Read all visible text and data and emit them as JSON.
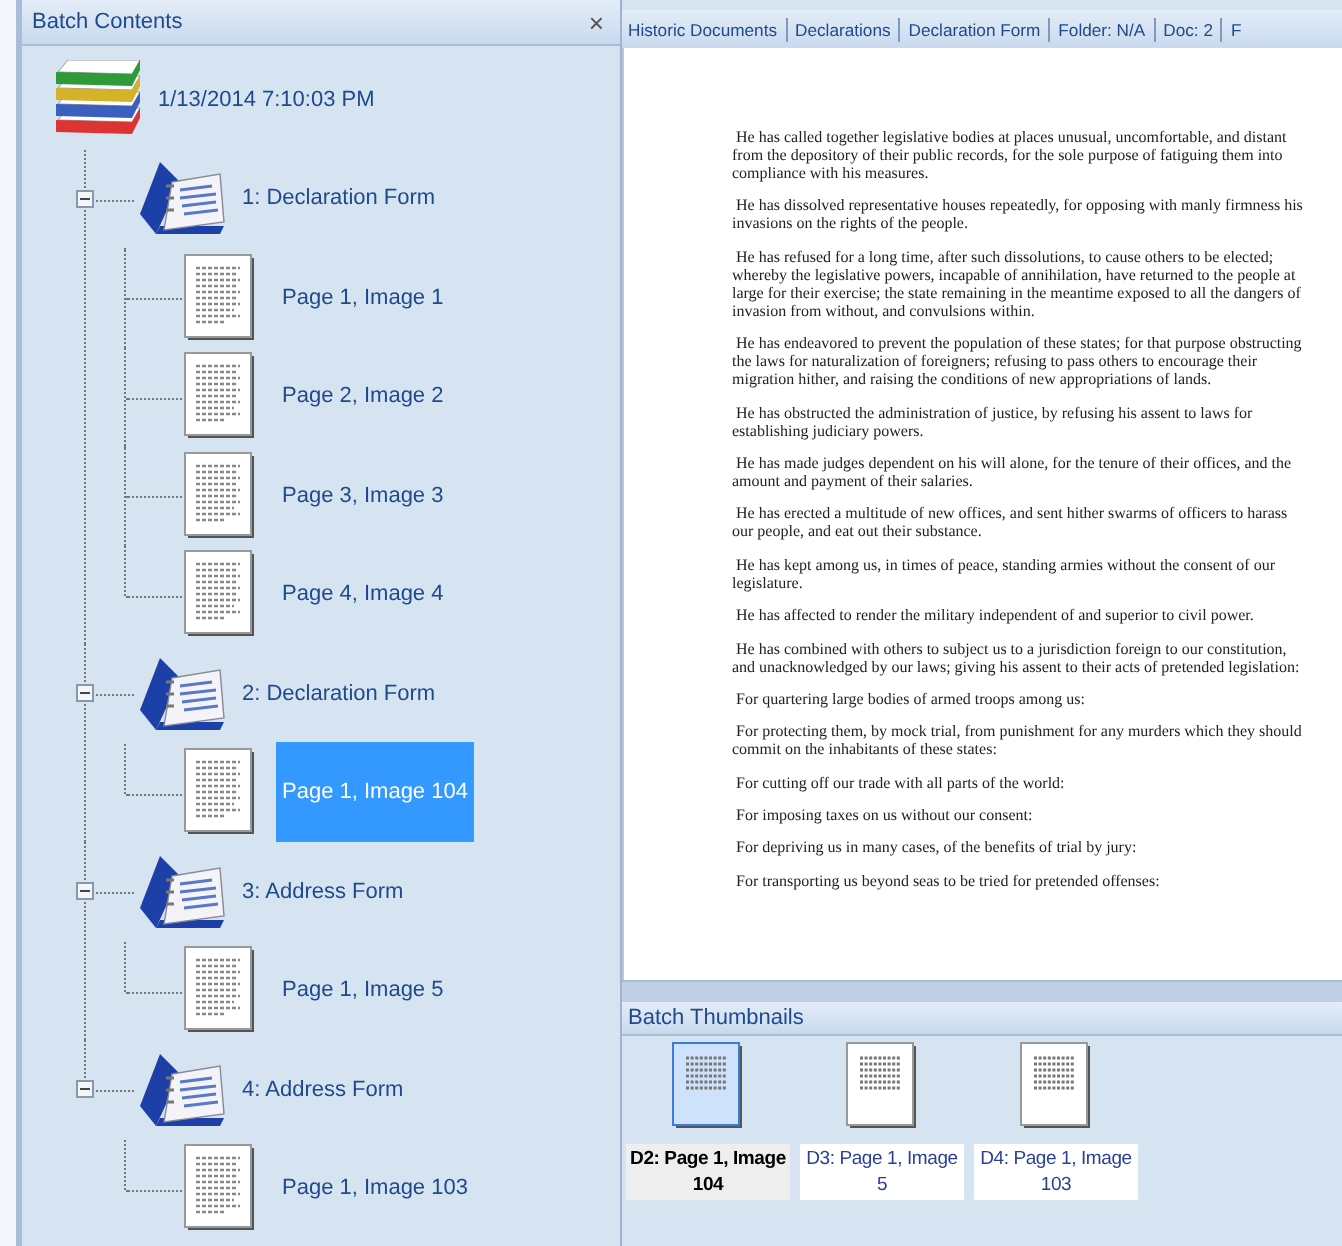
{
  "batch_contents": {
    "title": "Batch Contents",
    "close": "×",
    "root": {
      "label": "1/13/2014 7:10:03 PM",
      "children": [
        {
          "label": "1: Declaration Form",
          "expanded": true,
          "children": [
            {
              "label": "Page 1, Image 1",
              "selected": false
            },
            {
              "label": "Page 2, Image 2",
              "selected": false
            },
            {
              "label": "Page 3, Image 3",
              "selected": false
            },
            {
              "label": "Page 4, Image 4",
              "selected": false
            }
          ]
        },
        {
          "label": "2: Declaration Form",
          "expanded": true,
          "children": [
            {
              "label": "Page 1, Image 104",
              "selected": true
            }
          ]
        },
        {
          "label": "3: Address Form",
          "expanded": true,
          "children": [
            {
              "label": "Page 1, Image 5",
              "selected": false
            }
          ]
        },
        {
          "label": "4: Address Form",
          "expanded": true,
          "children": [
            {
              "label": "Page 1, Image 103",
              "selected": false
            }
          ]
        }
      ]
    }
  },
  "breadcrumb": [
    "Historic Documents",
    "Declarations",
    "Declaration Form",
    "Folder: N/A",
    "Doc: 2",
    "F"
  ],
  "document": {
    "paragraphs": [
      "He has called together legislative bodies at places unusual, uncomfortable, and distant from the depository of their public records, for the sole purpose of fatiguing them into compliance with his measures.",
      "He has dissolved representative houses repeatedly, for opposing with manly firmness his invasions on the rights of the people.",
      "He has refused for a long time, after such dissolutions, to cause others to be elected; whereby the legislative powers, incapable of annihilation, have returned to the people at large for their exercise; the state remaining in the meantime exposed to all the dangers of invasion from without, and convulsions within.",
      "He has endeavored to prevent the population of these states; for that purpose obstructing the laws for naturalization of foreigners; refusing to pass others to encourage their migration hither, and raising the conditions of new appropriations of lands.",
      "He has obstructed the administration of justice, by refusing his assent to laws for establishing judiciary powers.",
      "He has made judges dependent on his will alone, for the tenure of their offices, and the amount and payment of their salaries.",
      "He has erected a multitude of new offices, and sent hither swarms of officers to harass our people, and eat out their substance.",
      "He has kept among us, in times of peace, standing armies without the consent of our legislature.",
      "He has affected to render the military independent of and superior to civil power.",
      "He has combined with others to subject us to a jurisdiction foreign to our constitution, and unacknowledged by our laws; giving his assent to their acts of pretended legislation:",
      "For quartering large bodies of armed troops among us:",
      "For protecting them, by mock trial, from punishment for any murders which they should commit on the inhabitants of these states:",
      "For cutting off our trade with all parts of the world:",
      "For imposing taxes on us without our consent:",
      "For depriving us in many cases, of the benefits of trial by jury:",
      "For transporting us beyond seas to be tried for pretended offenses:"
    ]
  },
  "batch_thumbnails": {
    "title": "Batch Thumbnails",
    "items": [
      {
        "label": "D2: Page 1, Image 104",
        "selected": true
      },
      {
        "label": "D3: Page 1, Image 5",
        "selected": false
      },
      {
        "label": "D4: Page 1, Image 103",
        "selected": false
      }
    ]
  }
}
